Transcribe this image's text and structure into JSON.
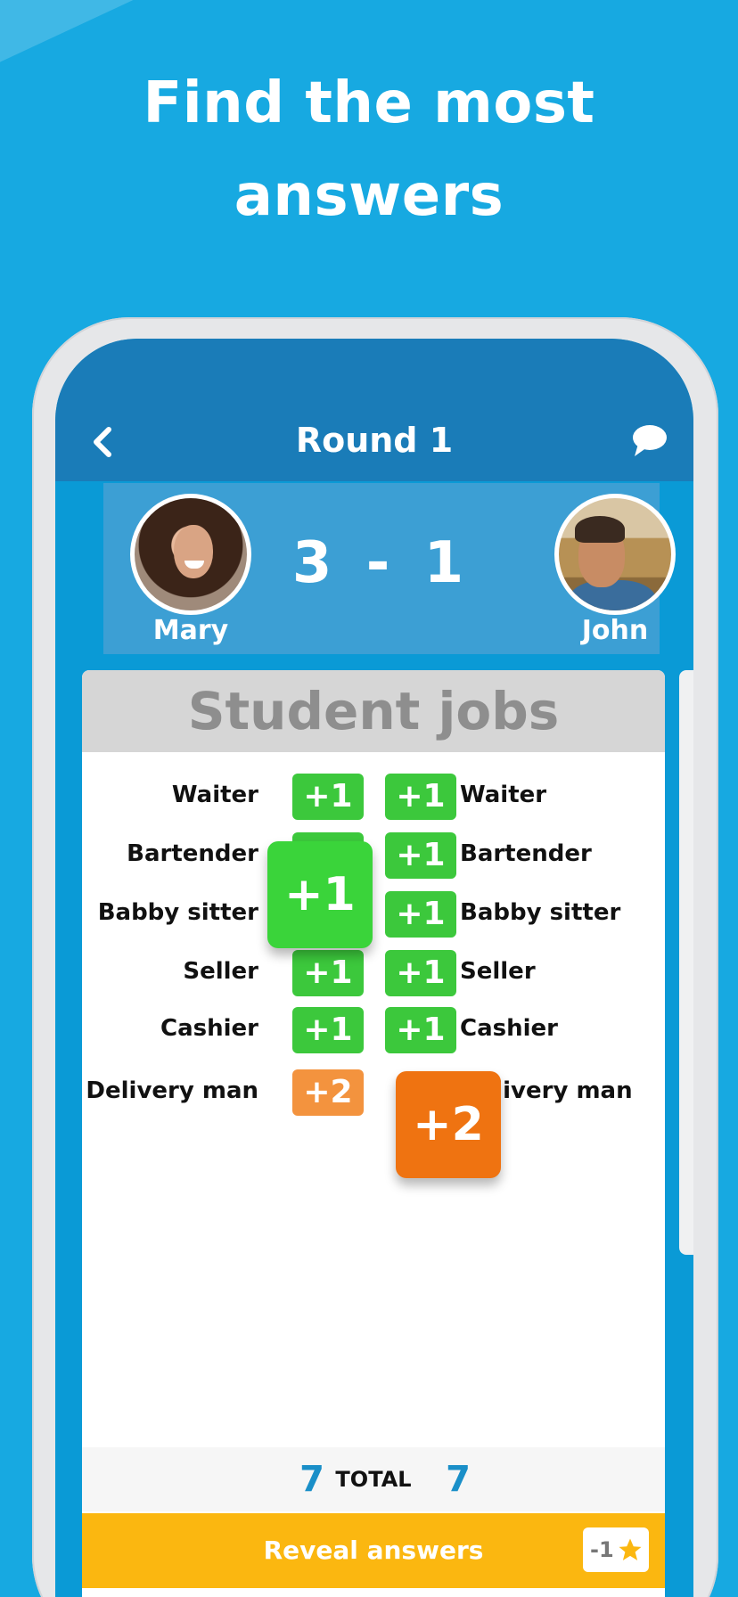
{
  "promo": {
    "line1": "Find the most",
    "line2": "answers"
  },
  "nav": {
    "back_label": "<",
    "title": "Round 1",
    "chat_icon": "chat-bubble-icon"
  },
  "players": {
    "left": {
      "name": "Mary"
    },
    "right": {
      "name": "John"
    },
    "score": "3 - 1"
  },
  "category": {
    "title": "Student jobs"
  },
  "rows": [
    {
      "left": "Waiter",
      "left_pts": "+1",
      "right_pts": "+1",
      "right": "Waiter"
    },
    {
      "left": "Bartender",
      "left_pts": "+1",
      "right_pts": "+1",
      "right": "Bartender"
    },
    {
      "left": "Babby sitter",
      "left_pts": "",
      "right_pts": "+1",
      "right": "Babby sitter"
    },
    {
      "left": "Seller",
      "left_pts": "+1",
      "right_pts": "+1",
      "right": "Seller"
    },
    {
      "left": "Cashier",
      "left_pts": "+1",
      "right_pts": "+1",
      "right": "Cashier"
    },
    {
      "left": "Delivery man",
      "left_pts": "+2",
      "right_pts": "",
      "right": "Delivery man"
    }
  ],
  "popups": {
    "green": "+1",
    "orange": "+2"
  },
  "totals": {
    "left": "7",
    "label": "TOTAL",
    "right": "7"
  },
  "reveal": {
    "label": "Reveal answers",
    "cost": "-1",
    "cost_icon": "star-icon"
  },
  "colors": {
    "background": "#17a9e1",
    "nav": "#1a7cb8",
    "green": "#3cc83c",
    "orange": "#f3933e",
    "reveal": "#fbb710"
  }
}
